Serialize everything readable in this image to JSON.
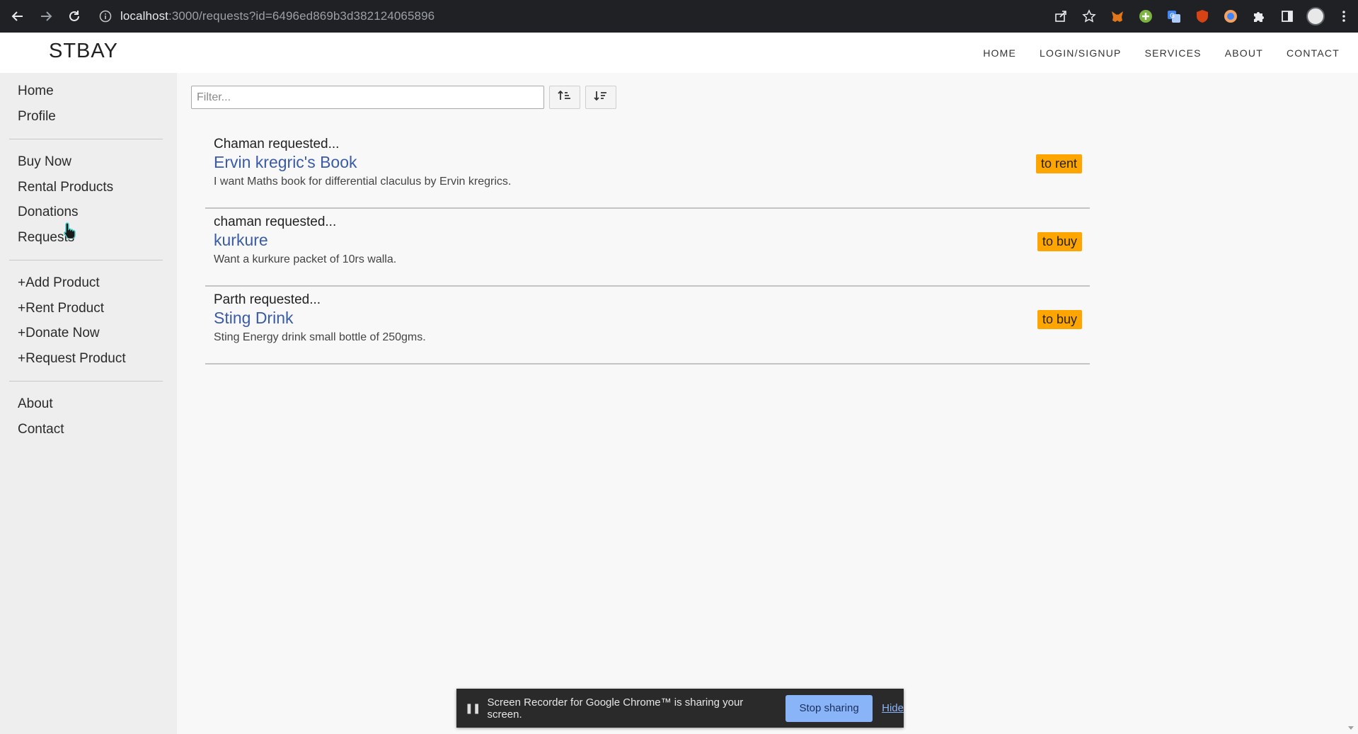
{
  "browser": {
    "url_host": "localhost",
    "url_rest": ":3000/requests?id=6496ed869b3d382124065896"
  },
  "site": {
    "brand": "STBAY",
    "nav": [
      "HOME",
      "LOGIN/SIGNUP",
      "SERVICES",
      "ABOUT",
      "CONTACT"
    ]
  },
  "sidebar": {
    "group1": [
      "Home",
      "Profile"
    ],
    "group2": [
      "Buy Now",
      "Rental Products",
      "Donations",
      "Requests"
    ],
    "group3": [
      "+Add Product",
      "+Rent Product",
      "+Donate Now",
      "+Request Product"
    ],
    "group4": [
      "About",
      "Contact"
    ]
  },
  "filter": {
    "placeholder": "Filter...",
    "sort_asc_icon": "sort-ascending-icon",
    "sort_desc_icon": "sort-descending-icon"
  },
  "requests": [
    {
      "requester": "Chaman requested...",
      "title": "Ervin kregric's Book",
      "description": "I want Maths book for differential claculus by Ervin kregrics.",
      "badge": "to rent"
    },
    {
      "requester": "chaman requested...",
      "title": "kurkure",
      "description": "Want a kurkure packet of 10rs walla.",
      "badge": "to buy"
    },
    {
      "requester": "Parth requested...",
      "title": "Sting Drink",
      "description": "Sting Energy drink small bottle of 250gms.",
      "badge": "to buy"
    }
  ],
  "sharebar": {
    "message": "Screen Recorder for Google Chrome™ is sharing your screen.",
    "stop_label": "Stop sharing",
    "hide_label": "Hide"
  },
  "colors": {
    "badge": "#ffa500",
    "link": "#3a5ba8",
    "sidebar_bg": "#eeeeee",
    "stop_button": "#8ab4f8"
  }
}
